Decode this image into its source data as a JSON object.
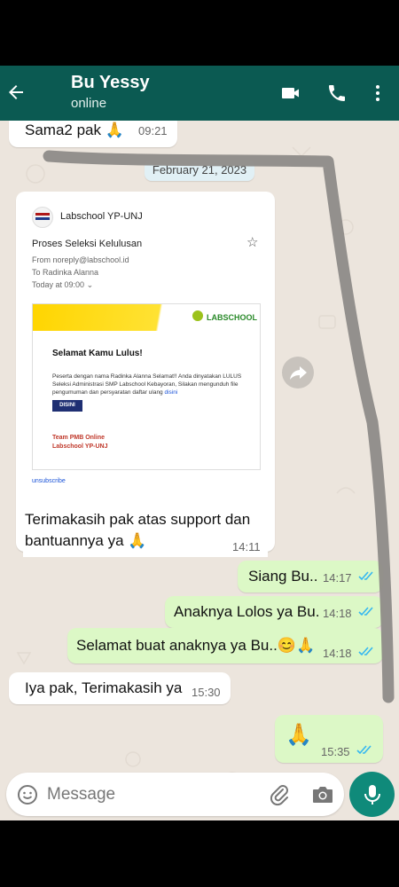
{
  "colors": {
    "header_bg": "#0b5a52",
    "chat_bg": "#ece5dd",
    "incoming": "#ffffff",
    "outgoing": "#dcf8c6",
    "read_ticks": "#34b7f1",
    "mic_bg": "#0f8a7a"
  },
  "header": {
    "contact_name": "Bu Yessy",
    "status": "online",
    "icons": [
      "back-arrow-icon",
      "avatar",
      "video-call-icon",
      "voice-call-icon",
      "more-options-icon"
    ]
  },
  "messages": {
    "m1": {
      "text": "Sama2 pak 🙏",
      "time": "09:21",
      "direction": "in"
    },
    "date_chip": "February 21, 2023",
    "email": {
      "sender": "Labschool YP-UNJ",
      "subject": "Proses Seleksi Kelulusan",
      "from": "From noreply@labschool.id",
      "to": "To Radinka Alanna",
      "date": "Today at 09:00",
      "brand": "LABSCHOOL",
      "heading": "Selamat Kamu Lulus!",
      "body": "Peserta dengan nama Radinka Alanna Selamat!! Anda dinyatakan LULUS Seleksi Administrasi SMP Labschool Kebayoran, Silakan mengunduh file pengumuman dan persyaratan daftar ulang",
      "link": "disini",
      "button": "DISINI",
      "team_line1": "Team PMB Online",
      "team_line2": "Labschool YP-UNJ",
      "unsubscribe": "unsubscribe",
      "caption": "Terimakasih pak atas support dan bantuannya ya 🙏",
      "time": "14:11"
    },
    "m3": {
      "text": "Siang Bu..",
      "time": "14:17",
      "direction": "out"
    },
    "m4": {
      "text": "Anaknya Lolos ya Bu.",
      "time": "14:18",
      "direction": "out"
    },
    "m5": {
      "text": "Selamat buat anaknya ya Bu..😊🙏",
      "time": "14:18",
      "direction": "out"
    },
    "m6": {
      "text": "Iya pak, Terimakasih ya",
      "time": "15:30",
      "direction": "in"
    },
    "m7": {
      "text": "🙏",
      "time": "15:35",
      "direction": "out"
    }
  },
  "input": {
    "placeholder": "Message",
    "icons": [
      "emoji-icon",
      "attach-icon",
      "camera-icon",
      "mic-icon"
    ]
  }
}
